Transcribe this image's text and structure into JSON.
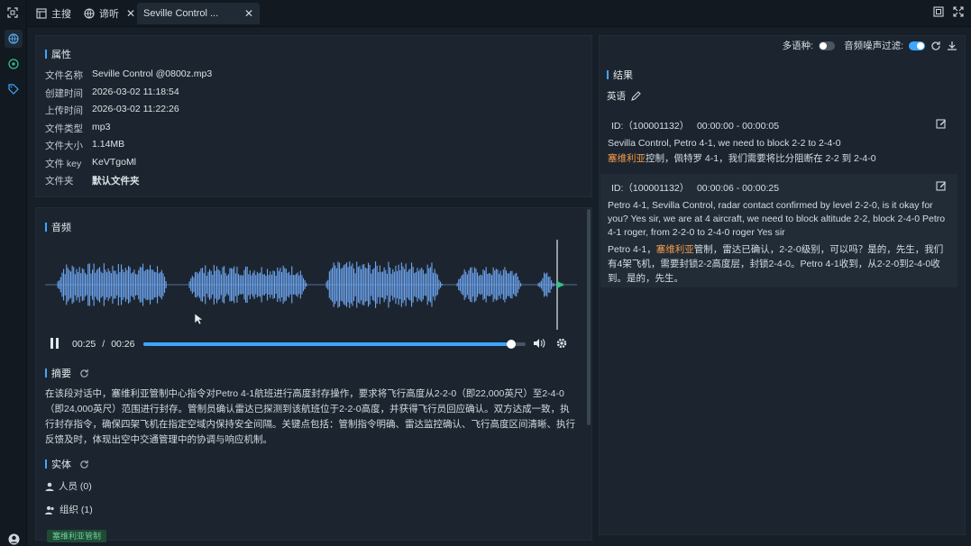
{
  "tabs": [
    {
      "label": "主搜"
    },
    {
      "label": "谛听"
    },
    {
      "label": "Seville Control ..."
    }
  ],
  "properties": {
    "title": "属性",
    "rows": [
      {
        "key": "文件名称",
        "value": "Seville Control @0800z.mp3"
      },
      {
        "key": "创建时间",
        "value": "2026-03-02 11:18:54"
      },
      {
        "key": "上传时间",
        "value": "2026-03-02 11:22:26"
      },
      {
        "key": "文件类型",
        "value": "mp3"
      },
      {
        "key": "文件大小",
        "value": "1.14MB"
      },
      {
        "key": "文件 key",
        "value": "KeVTgoMl"
      },
      {
        "key": "文件夹",
        "value": "默认文件夹"
      }
    ]
  },
  "audio": {
    "title": "音频",
    "current_time": "00:25",
    "separator": "/",
    "total_time": "00:26",
    "progress": 0.96,
    "waveform_color": "#6ea6f2",
    "accent_color": "#3ea6ff"
  },
  "summary": {
    "title": "摘要",
    "text": "在该段对话中，塞维利亚管制中心指令对Petro 4-1航班进行高度封存操作，要求将飞行高度从2-2-0（即22,000英尺）至2-4-0（即24,000英尺）范围进行封存。管制员确认雷达已探测到该航班位于2-2-0高度，并获得飞行员回应确认。双方达成一致，执行封存指令，确保四架飞机在指定空域内保持安全间隔。关键点包括：管制指令明确、雷达监控确认、飞行高度区间清晰、执行反馈及时，体现出空中交通管理中的协调与响应机制。"
  },
  "entities": {
    "title": "实体",
    "person": "人员 (0)",
    "org": "组织 (1)",
    "chip": "塞维利亚管制"
  },
  "toolbar": {
    "multilang_label": "多语种:",
    "noise_label": "音频噪声过滤:"
  },
  "results": {
    "title": "结果",
    "language": "英语",
    "segments": [
      {
        "id": "ID:（100001132）",
        "range": "00:00:00 - 00:00:05",
        "en": "Sevilla Control, Petro 4-1, we need to block 2-2 to 2-4-0",
        "zh_hl": "塞维利亚",
        "zh_rest": "控制，佩特罗 4-1，我们需要将比分阻断在 2-2 到 2-4-0"
      },
      {
        "id": "ID:（100001132）",
        "range": "00:00:06 - 00:00:25",
        "en": "Petro 4-1, Sevilla Control, radar contact confirmed by level 2-2-0, is it okay for you? Yes sir, we are at 4 aircraft, we need to block altitude 2-2, block 2-4-0 Petro 4-1 roger, from 2-2-0 to 2-4-0 roger Yes sir",
        "zh_pre": "Petro 4-1，",
        "zh_hl": "塞维利亚",
        "zh_rest": "管制，雷达已确认，2-2-0级别，可以吗？是的，先生，我们有4架飞机，需要封锁2-2高度层，封锁2-4-0。Petro 4-1收到，从2-2-0到2-4-0收到。是的，先生。"
      }
    ]
  }
}
